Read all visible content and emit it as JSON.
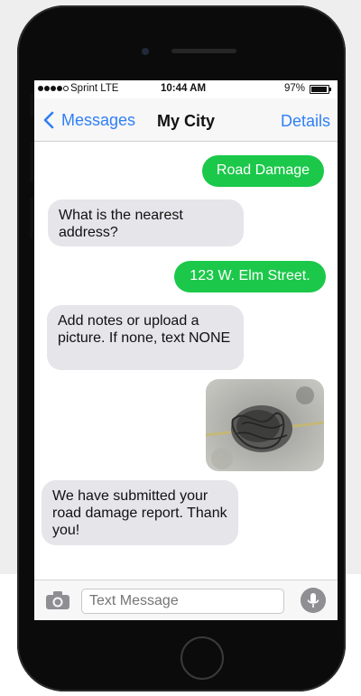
{
  "status_bar": {
    "carrier": "Sprint  LTE",
    "time": "10:44 AM",
    "battery": "97%",
    "battery_level": 0.97
  },
  "nav": {
    "back_label": "Messages",
    "title": "My City",
    "details_label": "Details"
  },
  "messages": [
    {
      "from": "me",
      "text": "Road Damage"
    },
    {
      "from": "them",
      "text": "What is the nearest address?"
    },
    {
      "from": "me",
      "text": "123 W. Elm Street."
    },
    {
      "from": "them",
      "text": "Add notes or upload a picture. If none, text NONE"
    },
    {
      "from": "me",
      "type": "image",
      "icon": "road-damage-photo"
    },
    {
      "from": "them",
      "text": "We have submitted your road damage report. Thank you!"
    }
  ],
  "composer": {
    "placeholder": "Text Message"
  },
  "colors": {
    "accent": "#2f7ff6",
    "outgoing_bubble": "#1cc84a",
    "incoming_bubble": "#e5e5ea"
  }
}
